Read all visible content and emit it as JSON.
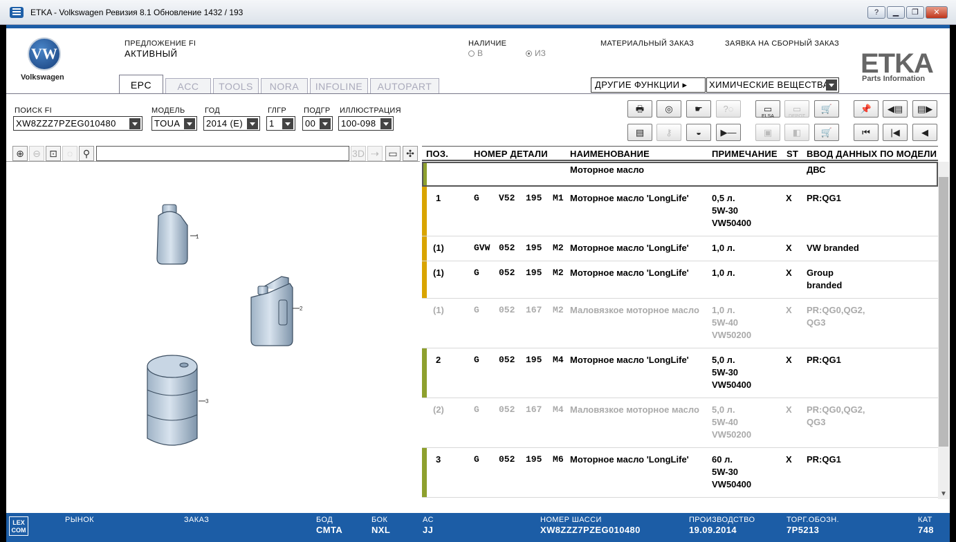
{
  "window": {
    "title": "ETKA - Volkswagen Ревизия 8.1 Обновление 1432 / 193"
  },
  "brand": {
    "name": "Volkswagen",
    "logo_letters": "VW",
    "etka": "ETKA",
    "etka_sub": "Parts Information"
  },
  "header": {
    "offer_label": "ПРЕДЛОЖЕНИЕ FI",
    "offer_value": "АКТИВНЫЙ",
    "availability_label": "НАЛИЧИЕ",
    "radio_v": "В",
    "radio_iz": "ИЗ",
    "material_order": "МАТЕРИАЛЬНЫЙ ЗАКАЗ",
    "assembly_order": "ЗАЯВКА НА СБОРНЫЙ ЗАКАЗ",
    "other_functions": "ДРУГИЕ ФУНКЦИИ ▸",
    "other_functions_value": "ХИМИЧЕСКИЕ ВЕЩЕСТВА"
  },
  "tabs": [
    {
      "label": "EPC",
      "active": true
    },
    {
      "label": "ACC"
    },
    {
      "label": "TOOLS"
    },
    {
      "label": "NORA"
    },
    {
      "label": "INFOLINE"
    },
    {
      "label": "AUTOPART"
    }
  ],
  "search": {
    "fi_label": "ПОИСК FI",
    "fi_value": "XW8ZZZ7PZEG010480",
    "model_label": "МОДЕЛЬ",
    "model_value": "TOUA",
    "year_label": "ГОД",
    "year_value": "2014 (E)",
    "glgr_label": "ГЛГР",
    "glgr_value": "1",
    "podgr_label": "ПОДГР",
    "podgr_value": "00",
    "illus_label": "ИЛЛЮСТРАЦИЯ",
    "illus_value": "100-098"
  },
  "toolbar": {
    "elsa": "ELSA",
    "depot": "DEPOT"
  },
  "viewer": {
    "btn_3d": "3D"
  },
  "illustration": {
    "callouts": [
      "1",
      "2",
      "3"
    ]
  },
  "table": {
    "headers": {
      "pos": "ПОЗ.",
      "part": "НОМЕР ДЕТАЛИ",
      "name": "НАИМЕНОВАНИЕ",
      "note": "ПРИМЕЧАНИЕ",
      "st": "ST",
      "model": "ВВОД ДАННЫХ ПО МОДЕЛИ"
    },
    "group_row": {
      "name": "Моторное масло",
      "model": "ДВС"
    },
    "rows": [
      {
        "pos": "1",
        "pref": "G",
        "part": "V52  195  M1",
        "name": "Моторное масло 'LongLife'",
        "note": [
          "0,5 л.",
          "5W-30",
          "VW50400"
        ],
        "st": "X",
        "model": [
          "PR:QG1"
        ]
      },
      {
        "pos": "(1)",
        "pref": "GVW",
        "part": "052  195  M2",
        "name": "Моторное масло 'LongLife'",
        "note": [
          "1,0 л."
        ],
        "st": "X",
        "model": [
          "VW branded"
        ]
      },
      {
        "pos": "(1)",
        "pref": "G",
        "part": "052  195  M2",
        "name": "Моторное масло 'LongLife'",
        "note": [
          "1,0 л."
        ],
        "st": "X",
        "model": [
          "Group",
          "branded"
        ]
      },
      {
        "pos": "(1)",
        "pref": "G",
        "part": "052  167  M2",
        "name": "Маловязкое моторное масло",
        "note": [
          "1,0 л.",
          "5W-40",
          "VW50200"
        ],
        "st": "X",
        "model": [
          "PR:QG0,QG2,",
          "QG3"
        ]
      },
      {
        "pos": "2",
        "pref": "G",
        "part": "052  195  M4",
        "name": "Моторное масло 'LongLife'",
        "note": [
          "5,0 л.",
          "5W-30",
          "VW50400"
        ],
        "st": "X",
        "model": [
          "PR:QG1"
        ]
      },
      {
        "pos": "(2)",
        "pref": "G",
        "part": "052  167  M4",
        "name": "Маловязкое моторное масло",
        "note": [
          "5,0 л.",
          "5W-40",
          "VW50200"
        ],
        "st": "X",
        "model": [
          "PR:QG0,QG2,",
          "QG3"
        ]
      },
      {
        "pos": "3",
        "pref": "G",
        "part": "052  195  M6",
        "name": "Моторное масло 'LongLife'",
        "note": [
          "60 л.",
          "5W-30",
          "VW50400"
        ],
        "st": "X",
        "model": [
          "PR:QG1"
        ]
      }
    ]
  },
  "status": {
    "lexcom": "LEX COM",
    "market_label": "РЫНОК",
    "order_label": "ЗАКАЗ",
    "bod_label": "БОД",
    "bod_value": "CMTA",
    "bok_label": "БОК",
    "bok_value": "NXL",
    "ac_label": "АС",
    "ac_value": "JJ",
    "chassis_label": "НОМЕР ШАССИ",
    "chassis_value": "XW8ZZZ7PZEG010480",
    "prod_label": "ПРОИЗВОДСТВО",
    "prod_value": "19.09.2014",
    "trade_label": "ТОРГ.ОБОЗН.",
    "trade_value": "7P5213",
    "kat_label": "КАТ",
    "kat_value": "748"
  },
  "colors": {
    "brand_blue": "#1c5da6",
    "row_bar_yellow": "#d9a400",
    "row_bar_green": "#8ea02e"
  }
}
